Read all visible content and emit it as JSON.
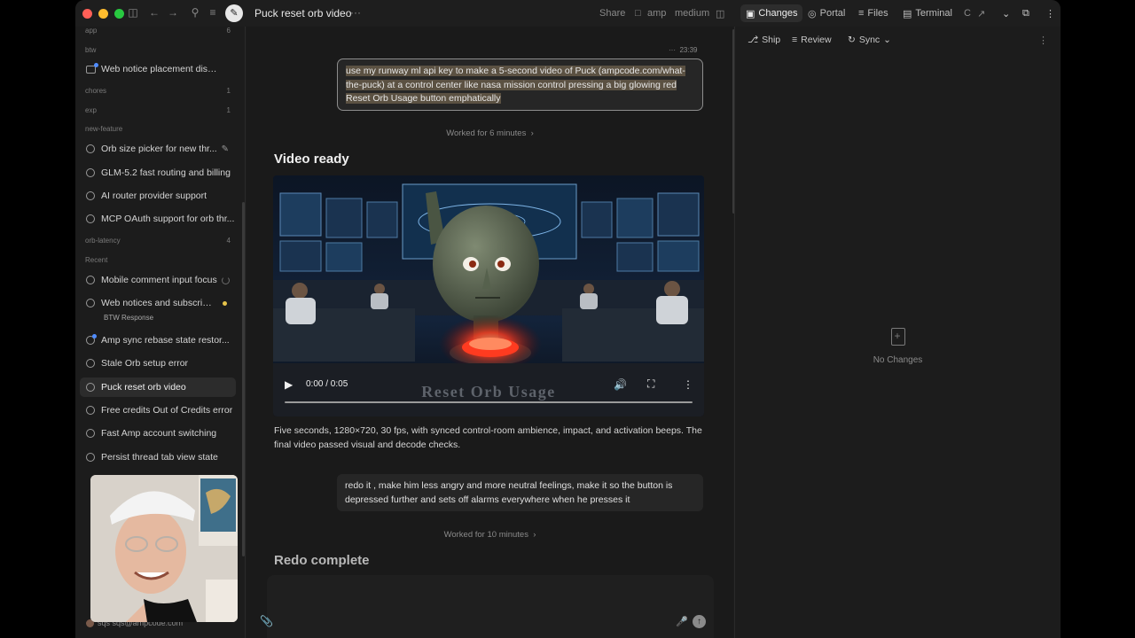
{
  "titlebar": {
    "thread_title": "Puck reset orb video",
    "more": "···",
    "share": "Share",
    "repo": "amp",
    "mode": "medium",
    "tabs": [
      {
        "label": "Changes"
      },
      {
        "label": "Portal"
      },
      {
        "label": "Files"
      },
      {
        "label": "Terminal"
      }
    ]
  },
  "sidebar": {
    "groups": {
      "app": {
        "label": "app",
        "count": "6"
      },
      "btw": {
        "label": "btw"
      },
      "chores": {
        "label": "chores",
        "count": "1"
      },
      "exp": {
        "label": "exp",
        "count": "1"
      },
      "new_feature": {
        "label": "new-feature"
      },
      "orb_latency": {
        "label": "orb-latency",
        "count": "4"
      },
      "recent": {
        "label": "Recent"
      }
    },
    "items": [
      {
        "label": "Web notice placement distinct..."
      },
      {
        "label": "Orb size picker for new thr..."
      },
      {
        "label": "GLM-5.2 fast routing and billing"
      },
      {
        "label": "AI router provider support"
      },
      {
        "label": "MCP OAuth support for orb thr..."
      },
      {
        "label": "Mobile comment input focus"
      },
      {
        "label": "Web notices and subscript...",
        "sub": "BTW Response"
      },
      {
        "label": "Amp sync rebase state restor..."
      },
      {
        "label": "Stale Orb setup error"
      },
      {
        "label": "Puck reset orb video"
      },
      {
        "label": "Free credits Out of Credits error"
      },
      {
        "label": "Fast Amp account switching"
      },
      {
        "label": "Persist thread tab view state"
      }
    ],
    "user": "sqs   sqs@ampcode.com"
  },
  "chat": {
    "time": "23:39",
    "msg1": {
      "highlighted": "use my runway ml api key to make a 5-second video of Puck (ampcode.com/what-the-puck) at a control center like nasa mission control pressing a big glowing red Reset Orb Usage button emphatically"
    },
    "worked1": "Worked for 6 minutes",
    "video_title": "Video ready",
    "video": {
      "time": "0:00 / 0:05",
      "button_text": "Reset Orb Usage",
      "progress": 0
    },
    "desc": "Five seconds, 1280×720, 30 fps, with synced control-room ambience, impact, and activation beeps. The final video passed visual and decode checks.",
    "msg2": "redo it , make him less angry and more neutral feelings, make it so the button is depressed further and sets off alarms everywhere when he presses it",
    "worked2": "Worked for 10 minutes",
    "redo_title": "Redo complete"
  },
  "right_panel": {
    "ship": "Ship",
    "review": "Review",
    "sync": "Sync",
    "empty": "No Changes"
  },
  "colors": {
    "accent_blue": "#4f8cff",
    "button_red": "#ff3b20",
    "highlight": "#5b5142"
  }
}
